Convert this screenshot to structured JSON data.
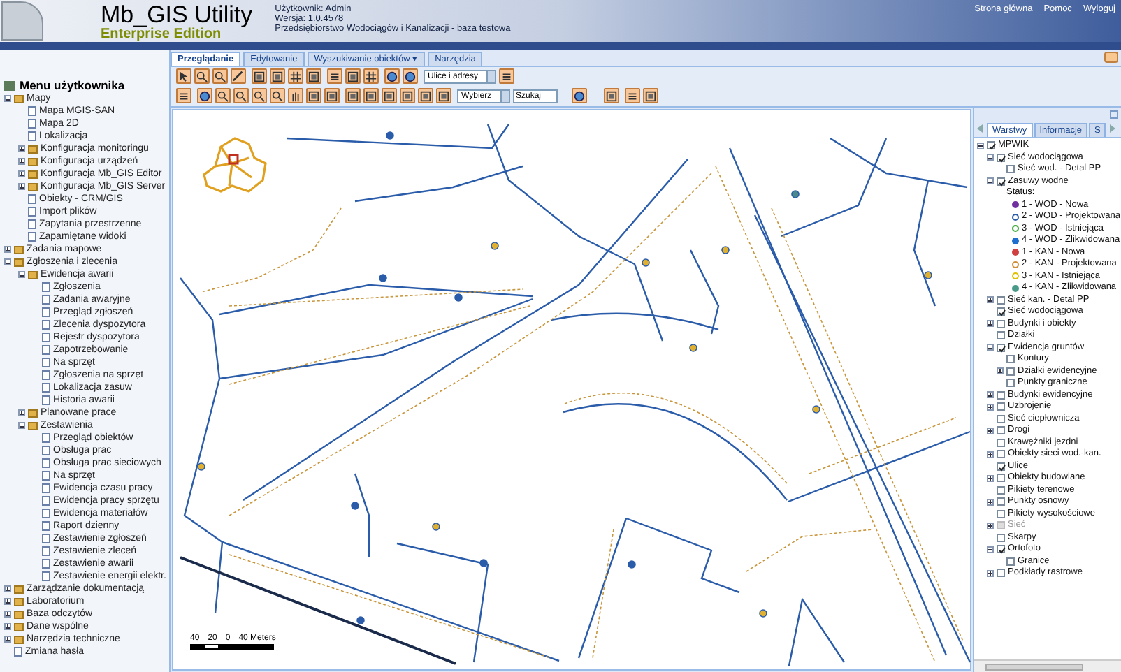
{
  "header": {
    "app_title": "Mb_GIS Utility",
    "edition": "Enterprise Edition",
    "info_lines": [
      "Użytkownik: Admin",
      "Wersja: 1.0.4578",
      "Przedsiębiorstwo Wodociągów i Kanalizacji - baza testowa"
    ],
    "links": [
      "Strona główna",
      "Pomoc",
      "Wyloguj"
    ]
  },
  "tabs": [
    {
      "label": "Przeglądanie",
      "selected": true
    },
    {
      "label": "Edytowanie",
      "selected": false
    },
    {
      "label": "Wyszukiwanie obiektów ▾",
      "selected": false
    },
    {
      "label": "Narzędzia",
      "selected": false
    }
  ],
  "toolbar": {
    "layer_select": "Ulice i adresy",
    "search_select": "Wybierz",
    "search_input": "Szukaj"
  },
  "menu": {
    "title": "Menu użytkownika",
    "items": [
      {
        "label": "Mapy",
        "expanded": true,
        "children": [
          {
            "label": "Mapa MGIS-SAN"
          },
          {
            "label": "Mapa 2D"
          },
          {
            "label": "Lokalizacja"
          },
          {
            "label": "Konfiguracja monitoringu",
            "expanded": false
          },
          {
            "label": "Konfiguracja urządzeń",
            "expanded": false
          },
          {
            "label": "Konfiguracja Mb_GIS Editor",
            "expanded": false
          },
          {
            "label": "Konfiguracja Mb_GIS Server",
            "expanded": false
          },
          {
            "label": "Obiekty - CRM/GIS"
          },
          {
            "label": "Import plików"
          },
          {
            "label": "Zapytania przestrzenne"
          },
          {
            "label": "Zapamiętane widoki"
          }
        ]
      },
      {
        "label": "Zadania mapowe",
        "expanded": false
      },
      {
        "label": "Zgłoszenia i zlecenia",
        "expanded": true,
        "children": [
          {
            "label": "Ewidencja awarii",
            "expanded": true,
            "children": [
              {
                "label": "Zgłoszenia"
              },
              {
                "label": "Zadania awaryjne"
              },
              {
                "label": "Przegląd zgłoszeń"
              },
              {
                "label": "Zlecenia dyspozytora"
              },
              {
                "label": "Rejestr dyspozytora"
              },
              {
                "label": "Zapotrzebowanie"
              },
              {
                "label": "Na sprzęt"
              },
              {
                "label": "Zgłoszenia na sprzęt"
              },
              {
                "label": "Lokalizacja zasuw"
              },
              {
                "label": "Historia awarii"
              }
            ]
          },
          {
            "label": "Planowane prace",
            "expanded": false
          },
          {
            "label": "Zestawienia",
            "expanded": true,
            "children": [
              {
                "label": "Przegląd obiektów"
              },
              {
                "label": "Obsługa prac"
              },
              {
                "label": "Obsługa prac sieciowych"
              },
              {
                "label": "Na sprzęt"
              },
              {
                "label": "Ewidencja czasu pracy"
              },
              {
                "label": "Ewidencja pracy sprzętu"
              },
              {
                "label": "Ewidencja materiałów"
              },
              {
                "label": "Raport dzienny"
              },
              {
                "label": "Zestawienie zgłoszeń"
              },
              {
                "label": "Zestawienie zleceń"
              },
              {
                "label": "Zestawienie awarii"
              },
              {
                "label": "Zestawienie energii elektr."
              }
            ]
          }
        ]
      },
      {
        "label": "Zarządzanie dokumentacją",
        "expanded": false
      },
      {
        "label": "Laboratorium",
        "expanded": false
      },
      {
        "label": "Baza odczytów",
        "expanded": false
      },
      {
        "label": "Dane wspólne",
        "expanded": false
      },
      {
        "label": "Narzędzia techniczne",
        "expanded": false
      },
      {
        "label": "Zmiana hasła"
      }
    ]
  },
  "layers": {
    "tabs": [
      {
        "label": "Warstwy",
        "selected": true
      },
      {
        "label": "Informacje",
        "selected": false
      },
      {
        "label": "S",
        "selected": false
      }
    ],
    "tree": [
      {
        "kind": "layer",
        "label": "MPWIK",
        "checked": true,
        "expanded": true,
        "children": [
          {
            "kind": "layer",
            "label": "Sieć wodociągowa",
            "checked": true,
            "expanded": true,
            "children": [
              {
                "kind": "layer",
                "label": "Sieć wod. - Detal PP",
                "checked": false
              }
            ]
          },
          {
            "kind": "layer",
            "label": "Zasuwy wodne",
            "checked": true,
            "expanded": true,
            "children": [
              {
                "kind": "heading",
                "label": "Status:"
              },
              {
                "kind": "legend",
                "label": "1 - WOD - Nowa",
                "color": "#7030a0",
                "filled": true
              },
              {
                "kind": "legend",
                "label": "2 - WOD - Projektowana",
                "color": "#2a5caa",
                "filled": false
              },
              {
                "kind": "legend",
                "label": "3 - WOD - Istniejąca",
                "color": "#3aa83a",
                "filled": false
              },
              {
                "kind": "legend",
                "label": "4 - WOD - Zlikwidowana",
                "color": "#1f6fd0",
                "filled": true
              },
              {
                "kind": "legend",
                "label": "1 - KAN - Nowa",
                "color": "#d04040",
                "filled": true
              },
              {
                "kind": "legend",
                "label": "2 - KAN - Projektowana",
                "color": "#d0903a",
                "filled": false
              },
              {
                "kind": "legend",
                "label": "3 - KAN - Istniejąca",
                "color": "#e0c000",
                "filled": false
              },
              {
                "kind": "legend",
                "label": "4 - KAN - Zlikwidowana",
                "color": "#4a9a8a",
                "filled": true
              }
            ]
          },
          {
            "kind": "layer",
            "label": "Sieć kan. - Detal PP",
            "checked": false,
            "expanded": false
          },
          {
            "kind": "layer",
            "label": "Sieć wodociągowa",
            "checked": true
          },
          {
            "kind": "layer",
            "label": "Budynki i obiekty",
            "checked": false,
            "expanded": false
          },
          {
            "kind": "layer",
            "label": "Działki",
            "checked": false
          },
          {
            "kind": "layer",
            "label": "Ewidencja gruntów",
            "checked": true,
            "expanded": true,
            "children": [
              {
                "kind": "layer",
                "label": "Kontury",
                "checked": false
              },
              {
                "kind": "layer",
                "label": "Działki ewidencyjne",
                "checked": false,
                "expanded": false
              },
              {
                "kind": "layer",
                "label": "Punkty graniczne",
                "checked": false
              }
            ]
          },
          {
            "kind": "layer",
            "label": "Budynki ewidencyjne",
            "checked": false,
            "expanded": false
          },
          {
            "kind": "layer",
            "label": "Uzbrojenie",
            "checked": false,
            "expanded": false
          },
          {
            "kind": "layer",
            "label": "Sieć ciepłownicza",
            "checked": false
          },
          {
            "kind": "layer",
            "label": "Drogi",
            "checked": false,
            "expanded": false
          },
          {
            "kind": "layer",
            "label": "Krawężniki jezdni",
            "checked": false
          },
          {
            "kind": "layer",
            "label": "Obiekty sieci wod.-kan.",
            "checked": false,
            "expanded": false
          },
          {
            "kind": "layer",
            "label": "Ulice",
            "checked": true
          },
          {
            "kind": "layer",
            "label": "Obiekty budowlane",
            "checked": false,
            "expanded": false
          },
          {
            "kind": "layer",
            "label": "Pikiety terenowe",
            "checked": false
          },
          {
            "kind": "layer",
            "label": "Punkty osnowy",
            "checked": false,
            "expanded": false
          },
          {
            "kind": "layer",
            "label": "Pikiety wysokościowe",
            "checked": false
          },
          {
            "kind": "layer",
            "label": "Sieć",
            "checked": false,
            "disabled": true,
            "expanded": false
          },
          {
            "kind": "layer",
            "label": "Skarpy",
            "checked": false
          },
          {
            "kind": "layer",
            "label": "Ortofoto",
            "checked": true,
            "expanded": true,
            "children": [
              {
                "kind": "layer",
                "label": "Granice",
                "checked": false
              }
            ]
          },
          {
            "kind": "layer",
            "label": "Podkłady rastrowe",
            "checked": false,
            "expanded": false
          }
        ]
      }
    ]
  },
  "map": {
    "scale_labels": [
      "40",
      "20",
      "0",
      "40 Meters"
    ]
  }
}
